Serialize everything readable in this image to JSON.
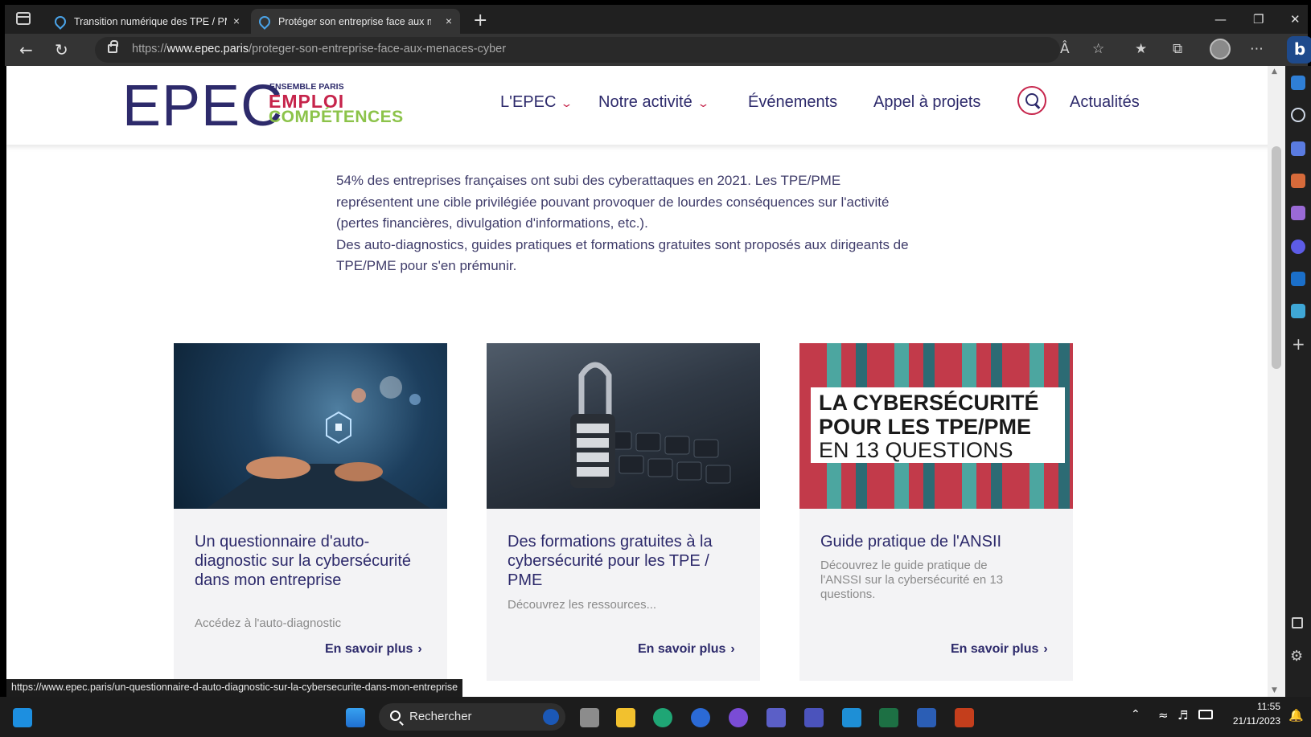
{
  "browser": {
    "tabs": [
      {
        "label": "Transition numérique des TPE / PME",
        "close": "×"
      },
      {
        "label": "Protéger son entreprise face aux menaces cyber",
        "close": "×"
      }
    ],
    "new_tab": "+",
    "url": {
      "prefix": "https://",
      "domain": "www.epec.paris",
      "path": "/proteger-son-entreprise-face-aux-menaces-cyber"
    }
  },
  "site": {
    "logo": {
      "letters": "EPEC",
      "line1": "ENSEMBLE PARIS",
      "line2": "EMPLOI",
      "line3": "COMPÉTENCES"
    },
    "menu": {
      "epec": "L'EPEC",
      "activite": "Notre activité",
      "evenements": "Événements",
      "appel": "Appel à projets",
      "actualites": "Actualités"
    },
    "intro": {
      "p1": "54% des entreprises françaises ont subi des cyberattaques en 2021. Les TPE/PME représentent une cible privilégiée pouvant provoquer de lourdes conséquences sur l'activité (pertes financières, divulgation d'informations, etc.).",
      "p2": "Des auto-diagnostics, guides pratiques et formations gratuites sont proposés aux dirigeants de TPE/PME pour s'en prémunir."
    },
    "cards": [
      {
        "title": "Un questionnaire d'auto-diagnostic sur la cybersécurité dans mon entreprise",
        "desc": "Accédez à l'auto-diagnostic",
        "link": "En savoir plus"
      },
      {
        "title": "Des formations gratuites à la cybersécurité pour les TPE / PME",
        "desc": "Découvrez les ressources...",
        "link": "En savoir plus"
      },
      {
        "title": "Guide pratique de l'ANSII",
        "desc": "Découvrez le guide pratique de l'ANSSI sur la cybersécurité en 13 questions.",
        "link": "En savoir plus",
        "image_text": {
          "l1": "LA CYBERSÉCURITÉ",
          "l2": "POUR LES TPE/PME",
          "l3": "EN 13 QUESTIONS"
        }
      }
    ]
  },
  "status_bar": {
    "url": "https://www.epec.paris/un-questionnaire-d-auto-diagnostic-sur-la-cybersecurite-dans-mon-entreprise"
  },
  "taskbar": {
    "search_placeholder": "Rechercher",
    "time": "11:55",
    "date": "21/11/2023"
  },
  "colors": {
    "brand_navy": "#2d2a6b",
    "brand_red": "#c6244b",
    "brand_green": "#8cc34a"
  }
}
